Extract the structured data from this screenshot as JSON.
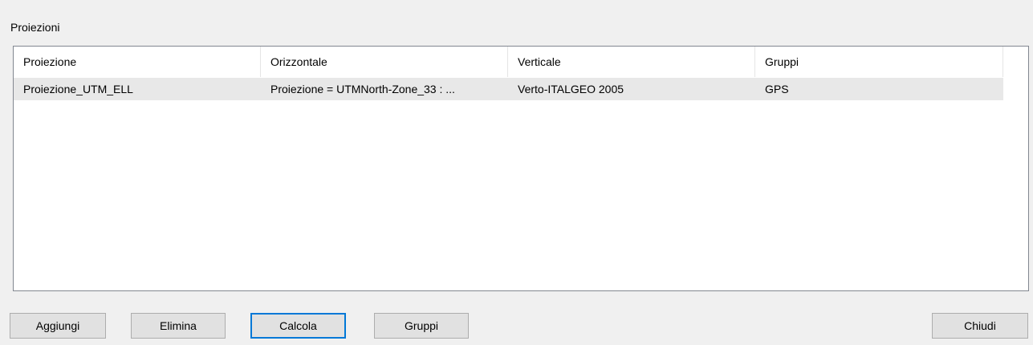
{
  "section": {
    "label": "Proiezioni"
  },
  "table": {
    "columns": [
      "Proiezione",
      "Orizzontale",
      "Verticale",
      "Gruppi"
    ],
    "rows": [
      [
        "Proiezione_UTM_ELL",
        "Proiezione = UTMNorth-Zone_33 : ...",
        "Verto-ITALGEO 2005",
        "GPS"
      ]
    ]
  },
  "buttons": {
    "aggiungi": "Aggiungi",
    "elimina": "Elimina",
    "calcola": "Calcola",
    "gruppi": "Gruppi",
    "chiudi": "Chiudi"
  },
  "colors": {
    "selected_row": "#e8e8e8",
    "default_button_border": "#0078d7"
  }
}
